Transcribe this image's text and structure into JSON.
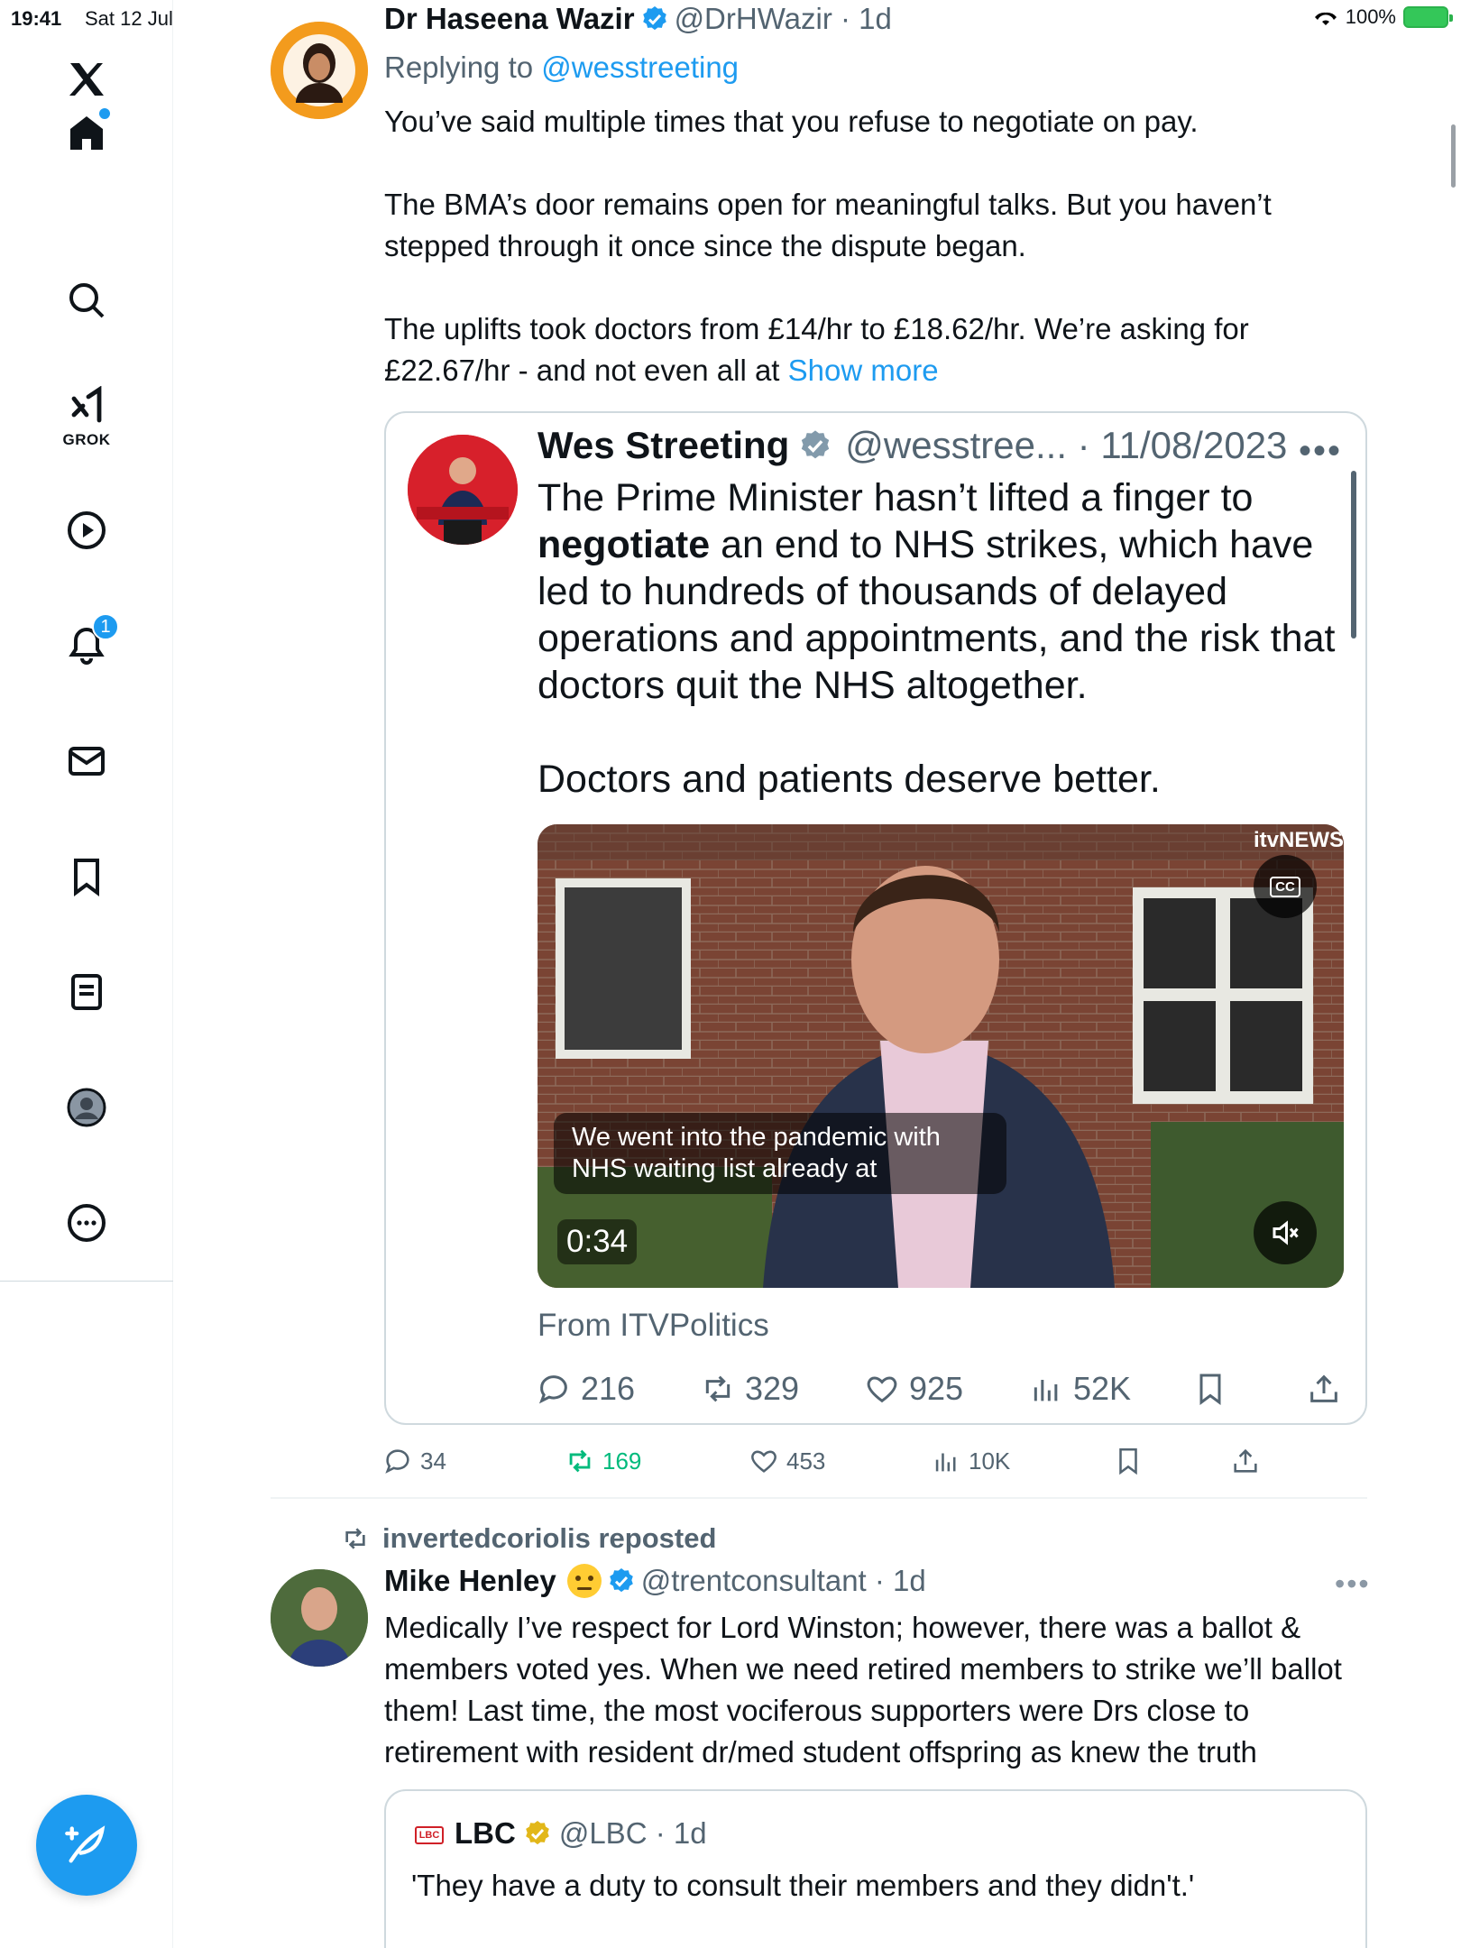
{
  "status_bar": {
    "time": "19:41",
    "date": "Sat 12 Jul",
    "battery": "100%"
  },
  "nav": {
    "grok_label": "GROK",
    "notifications_badge": "1",
    "items": [
      "home-icon",
      "search-icon",
      "grok-icon",
      "video-icon",
      "notifications-icon",
      "messages-icon",
      "bookmarks-icon",
      "lists-icon",
      "profile-icon",
      "more-icon"
    ]
  },
  "tweet1": {
    "author_name": "Dr Haseena Wazir",
    "handle_time": "@DrHWazir · 1d",
    "replying_label": "Replying to",
    "replying_handle": "@wesstreeting",
    "paragraphs": [
      "You’ve said multiple times that you refuse to negotiate on pay.",
      "The BMA’s door remains open for meaningful talks. But you haven’t stepped through it once since the dispute began.",
      "The uplifts took doctors from £14/hr to £18.62/hr. We’re asking for £22.67/hr - and not even all at "
    ],
    "show_more": "Show more",
    "actions": {
      "replies": "34",
      "reposts": "169",
      "likes": "453",
      "views": "10K"
    }
  },
  "quoted_tweet": {
    "author_name": "Wes Streeting",
    "handle_date": "@wesstree... · 11/08/2023",
    "text_pre": "The Prime Minister hasn’t lifted a finger to ",
    "text_bold": "negotiate",
    "text_post": " an end to NHS strikes, which have led to hundreds of thousands of delayed operations and appointments, and the risk that doctors quit the NHS altogether.",
    "text_p2": "Doctors and patients deserve better.",
    "video": {
      "logo": "itvNEWS",
      "cc": "CC",
      "caption": "We went into the pandemic with NHS waiting list already at",
      "duration": "0:34"
    },
    "from_label": "From ITVPolitics",
    "actions": {
      "replies": "216",
      "reposts": "329",
      "likes": "925",
      "views": "52K"
    }
  },
  "tweet2": {
    "repost_label": "invertedcoriolis reposted",
    "author_name": "Mike Henley",
    "handle_time": "@trentconsultant · 1d",
    "text": "Medically I’ve respect for Lord Winston; however, there was a ballot & members voted yes. When we need retired members to strike we’ll ballot them! Last time, the most vociferous supporters were Drs close to retirement with resident dr/med student offspring as knew the truth"
  },
  "lbc_quote": {
    "logo": "LBC",
    "author_name": "LBC",
    "handle_time": "@LBC · 1d",
    "text": "'They have a duty to consult their members and they didn't.'"
  },
  "colors": {
    "accent": "#1d9bf0",
    "repost_green": "#00ba7c",
    "secondary_text": "#536471",
    "border": "#cfd9de"
  }
}
